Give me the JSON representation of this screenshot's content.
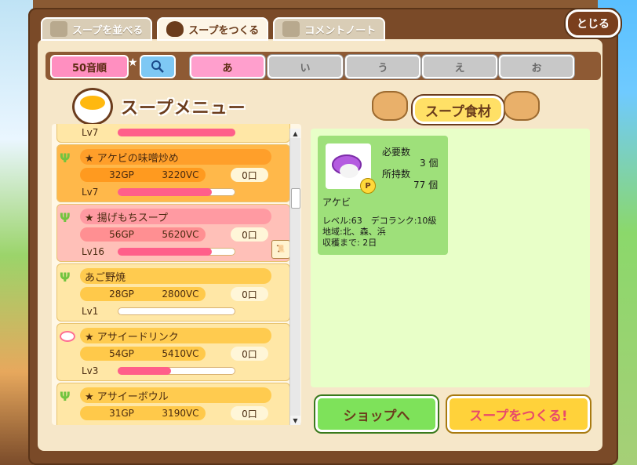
{
  "close_label": "とじる",
  "tabs": [
    {
      "label": "スープを並べる",
      "icon": "shelf-icon"
    },
    {
      "label": "スープをつくる",
      "icon": "pot-icon"
    },
    {
      "label": "コメントノート",
      "icon": "notebook-icon"
    }
  ],
  "filter": {
    "sort_label": "50音順",
    "kana": [
      "あ",
      "い",
      "う",
      "え",
      "お"
    ]
  },
  "menu_title": "スープメニュー",
  "ingredients_title": "スープ食材",
  "items": [
    {
      "name": "",
      "gp": "",
      "vc": "",
      "qty": "",
      "level": "Lv7",
      "level_progress": 1.0
    },
    {
      "name": "★ アケビの味噌炒め",
      "gp": "32GP",
      "vc": "3220VC",
      "qty": "0口",
      "level": "Lv7",
      "level_progress": 0.8
    },
    {
      "name": "★ 揚げもちスープ",
      "gp": "56GP",
      "vc": "5620VC",
      "qty": "0口",
      "level": "Lv16",
      "level_progress": 0.8
    },
    {
      "name": "あご野焼",
      "gp": "28GP",
      "vc": "2800VC",
      "qty": "0口",
      "level": "Lv1",
      "level_progress": 0.0
    },
    {
      "name": "★ アサイードリンク",
      "gp": "54GP",
      "vc": "5410VC",
      "qty": "0口",
      "level": "Lv3",
      "level_progress": 0.45
    },
    {
      "name": "★ アサイーボウル",
      "gp": "31GP",
      "vc": "3190VC",
      "qty": "0口",
      "level": "",
      "level_progress": 0
    }
  ],
  "ingredient": {
    "name": "アケビ",
    "required_label": "必要数",
    "required_value": "3 個",
    "owned_label": "所持数",
    "owned_value": "77 個",
    "level_line": "レベル:63　デコランク:10級",
    "region_line": "地域:北、森、浜",
    "harvest_line": "収穫まで: 2日",
    "badge": "P"
  },
  "buttons": {
    "shop": "ショップへ",
    "make": "スープをつくる!"
  }
}
